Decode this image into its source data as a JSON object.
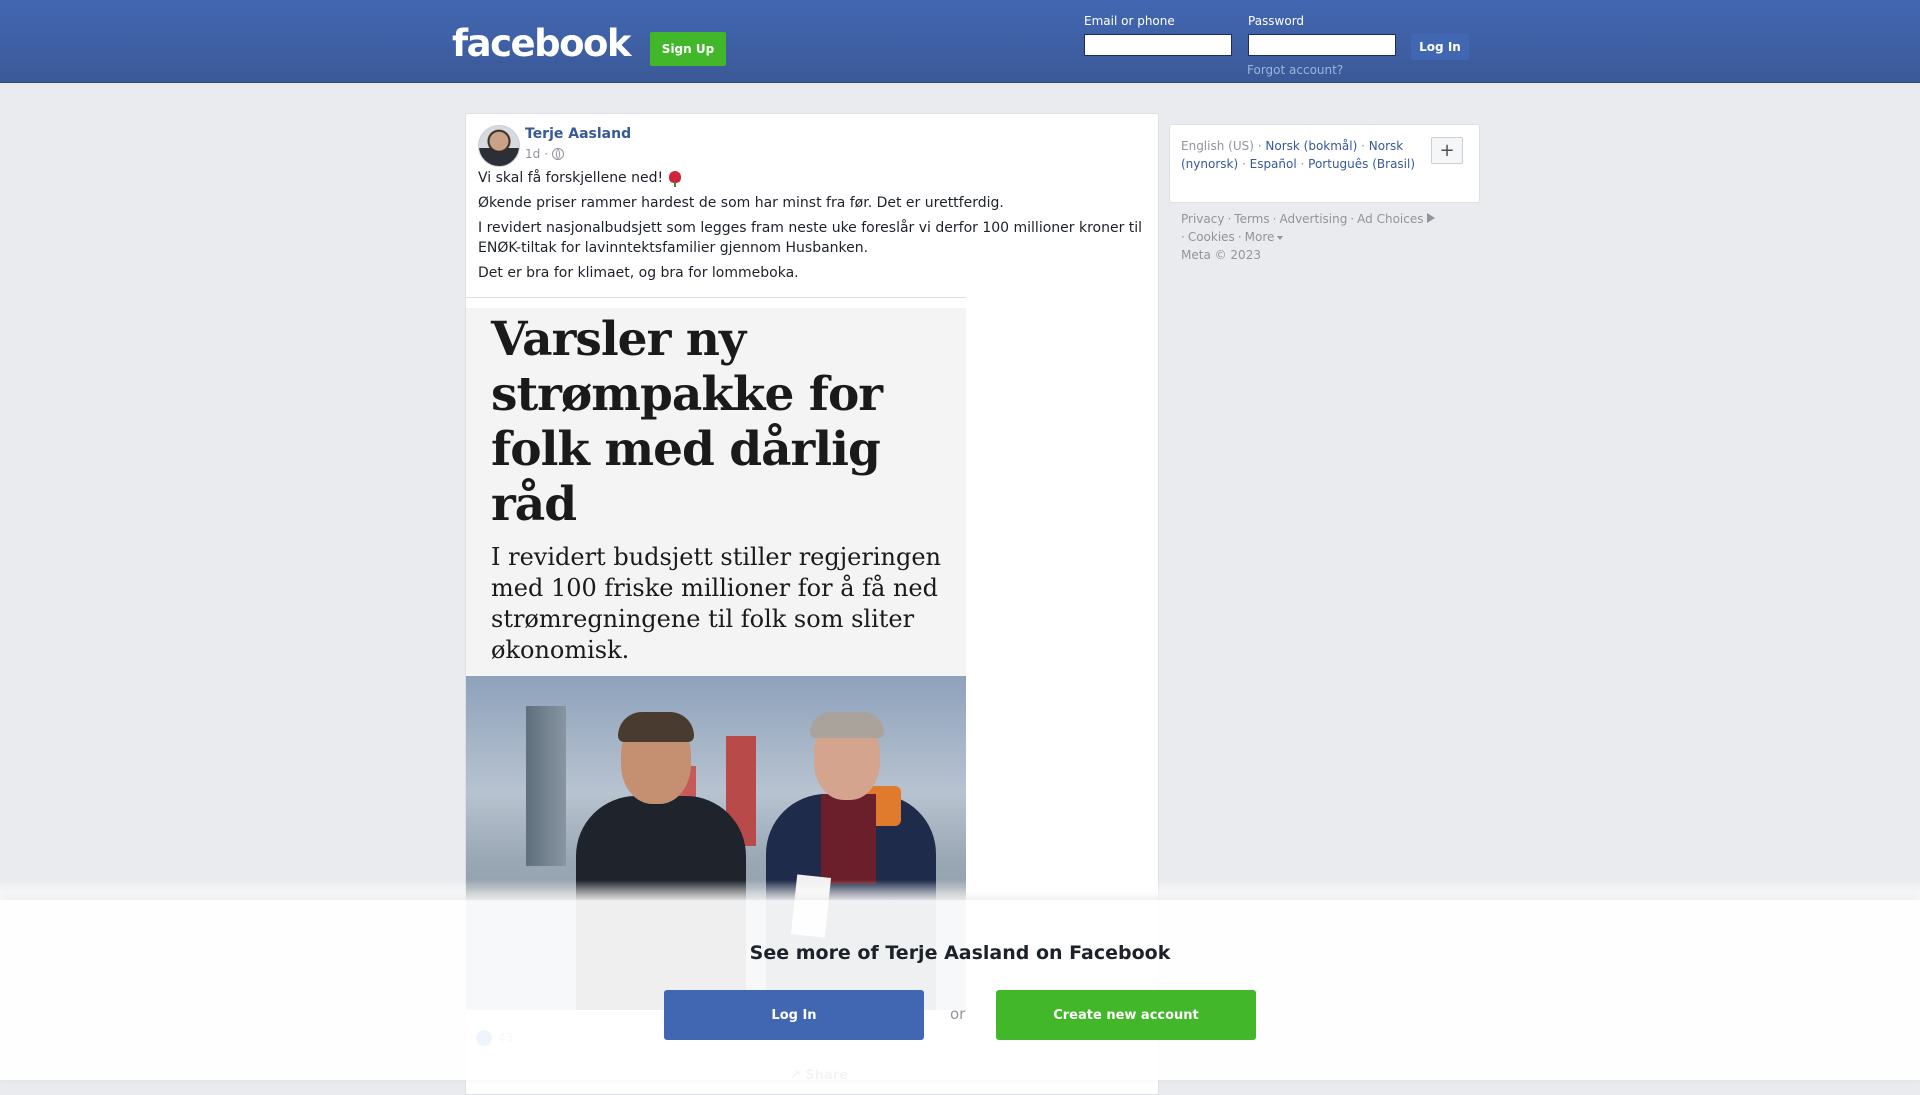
{
  "header": {
    "logo": "facebook",
    "signup_label": "Sign Up",
    "email_label": "Email or phone",
    "password_label": "Password",
    "login_label": "Log In",
    "forgot_label": "Forgot account?"
  },
  "post": {
    "author": "Terje Aasland",
    "time": "1d",
    "visibility_icon": "globe-icon",
    "paragraphs": [
      "Vi skal få forskjellene ned!",
      "Økende priser rammer hardest de som har minst fra før. Det er urettferdig.",
      "I revidert nasjonalbudsjett som legges fram neste uke foreslår vi derfor 100 millioner kroner til ENØK-tiltak for lavinntektsfamilier gjennom Husbanken.",
      "Det er bra for klimaet, og bra for lommeboka."
    ],
    "image_headline": "Varsler ny strømpakke for folk med dårlig råd",
    "image_deck": "I revidert budsjett stiller regjeringen med 100 friske millioner for å få ned strømregningene til folk som sliter økonomisk.",
    "reaction_count": "43",
    "share_label": "Share"
  },
  "sidebar": {
    "current_language": "English (US)",
    "languages": [
      "Norsk (bokmål)",
      "Norsk (nynorsk)",
      "Español",
      "Português (Brasil)"
    ],
    "add_language_label": "+",
    "footer_links": [
      "Privacy",
      "Terms",
      "Advertising",
      "Ad Choices",
      "Cookies",
      "More"
    ],
    "copyright": "Meta © 2023"
  },
  "overlay": {
    "title": "See more of Terje Aasland on Facebook",
    "login_label": "Log In",
    "or_label": "or",
    "create_label": "Create new account"
  },
  "colors": {
    "brand_blue": "#3b5998",
    "green": "#42b72a",
    "link": "#385898"
  }
}
